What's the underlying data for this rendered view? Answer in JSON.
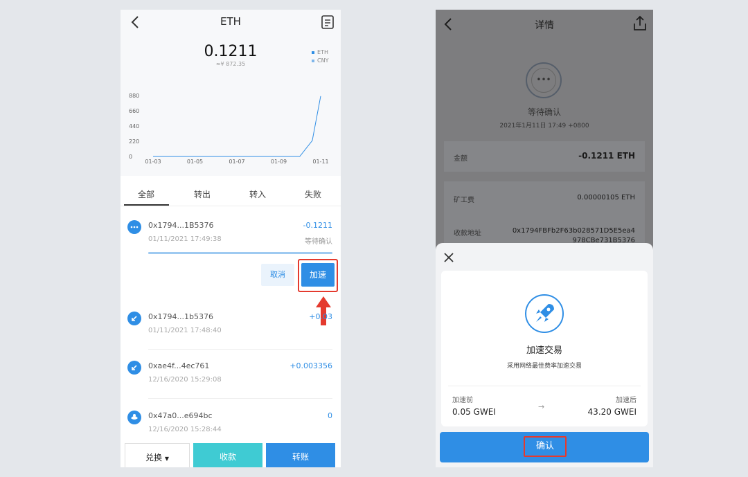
{
  "left": {
    "header": {
      "title": "ETH",
      "balance": "0.1211",
      "cny_value": "≈¥ 872.35"
    },
    "legend": [
      {
        "label": "ETH",
        "color": "#2f8ee5"
      },
      {
        "label": "CNY",
        "color": "#7fb6ea"
      }
    ],
    "tabs": [
      "全部",
      "转出",
      "转入",
      "失败"
    ],
    "active_tab": "全部",
    "transactions": [
      {
        "address": "0x1794...1B5376",
        "time": "01/11/2021 17:49:38",
        "amount": "-0.1211",
        "status": "等待确认",
        "icon": "pending-dots-icon"
      },
      {
        "address": "0x1794...1b5376",
        "time": "01/11/2021 17:48:40",
        "amount": "+0.03",
        "icon": "receive-arrow-icon"
      },
      {
        "address": "0xae4f...4ec761",
        "time": "12/16/2020 15:29:08",
        "amount": "+0.003356",
        "icon": "receive-arrow-icon"
      },
      {
        "address": "0x47a0...e694bc",
        "time": "12/16/2020 15:28:44",
        "amount": "0",
        "icon": "contract-icon"
      }
    ],
    "pending_progress": 1.0,
    "actions": {
      "cancel": "取消",
      "speed_up": "加速"
    },
    "bottom": {
      "swap": "兑换",
      "receive": "收款",
      "send": "转账"
    }
  },
  "chart_data": {
    "type": "line",
    "categories": [
      "01-03",
      "01-05",
      "01-07",
      "01-09",
      "01-11"
    ],
    "y_ticks": [
      "880",
      "660",
      "440",
      "220",
      "0"
    ],
    "ylim": [
      0,
      880
    ],
    "series": [
      {
        "x": [
          0,
          1,
          2,
          3,
          3.5,
          3.8,
          4.0
        ],
        "values": [
          0,
          0,
          0,
          0,
          0,
          230,
          872
        ]
      }
    ],
    "grid": false
  },
  "right": {
    "title": "详情",
    "pending_label": "等待确认",
    "pending_date": "2021年1月11日 17:49 +0800",
    "pending_glyph": "•••",
    "rows": [
      {
        "key": "金额",
        "value": "-0.1211 ETH"
      },
      {
        "key": "矿工费",
        "value": "0.00000105 ETH"
      },
      {
        "key": "收款地址",
        "value": "0x1794FBFb2F63b028571D5E5ea4",
        "value2": "978CBe731B5376"
      }
    ],
    "sheet": {
      "title": "加速交易",
      "subtitle": "采用网络最佳费率加速交易",
      "before_label": "加速前",
      "before_value": "0.05 GWEI",
      "after_label": "加速后",
      "after_value": "43.20 GWEI",
      "arrow": "→",
      "confirm": "确认"
    }
  },
  "colors": {
    "accent": "#2f8ee5",
    "teal": "#3fcbd3",
    "highlight": "#e43a2e"
  }
}
